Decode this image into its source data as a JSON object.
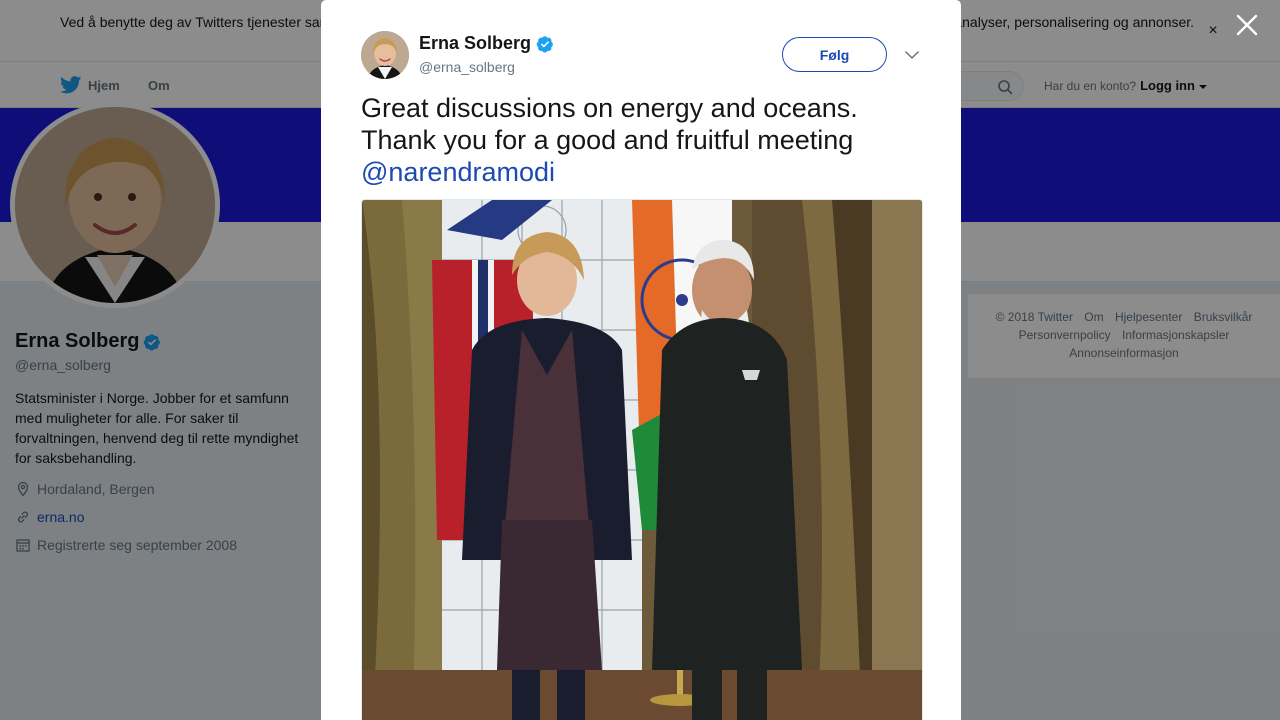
{
  "cookie_banner": {
    "text": "Ved å benytte deg av Twitters tjenester samtykker du til bruk av informasjonskapsler. Twitter og tredjeparter benytter informasjonskapsler til bl.a. analyser, personalisering og annonser.",
    "close_glyph": "×"
  },
  "nav": {
    "home_label": "Hjem",
    "about_label": "Om",
    "login_prompt": "Har du en konto?",
    "login_label": "Logg inn"
  },
  "profile": {
    "name": "Erna Solberg",
    "handle": "@erna_solberg",
    "bio": "Statsminister i Norge. Jobber for et samfunn med muligheter for alle. For saker til forvaltningen, henvend deg til rette myndighet for saksbehandling.",
    "location": "Hordaland, Bergen",
    "website": "erna.no",
    "joined": "Registrerte seg september 2008"
  },
  "footer": {
    "links": [
      "© 2018 Twitter",
      "Om",
      "Hjelpesenter",
      "Bruksvilkår",
      "Personvernpolicy",
      "Informasjonskapsler",
      "Annonseinformasjon"
    ]
  },
  "tweet": {
    "author_name": "Erna Solberg",
    "author_handle": "@erna_solberg",
    "follow_label": "Følg",
    "text": "Great discussions on energy and oceans. Thank you for a good and fruitful meeting ",
    "mention": "@narendramodi"
  },
  "colors": {
    "cover": "#1d19d9",
    "link": "#1b4ab3",
    "verified": "#1da1f2"
  },
  "icons": [
    "twitter-bird-icon",
    "search-icon",
    "verified-icon",
    "location-icon",
    "link-icon",
    "calendar-icon",
    "close-icon",
    "chevron-down-icon"
  ]
}
